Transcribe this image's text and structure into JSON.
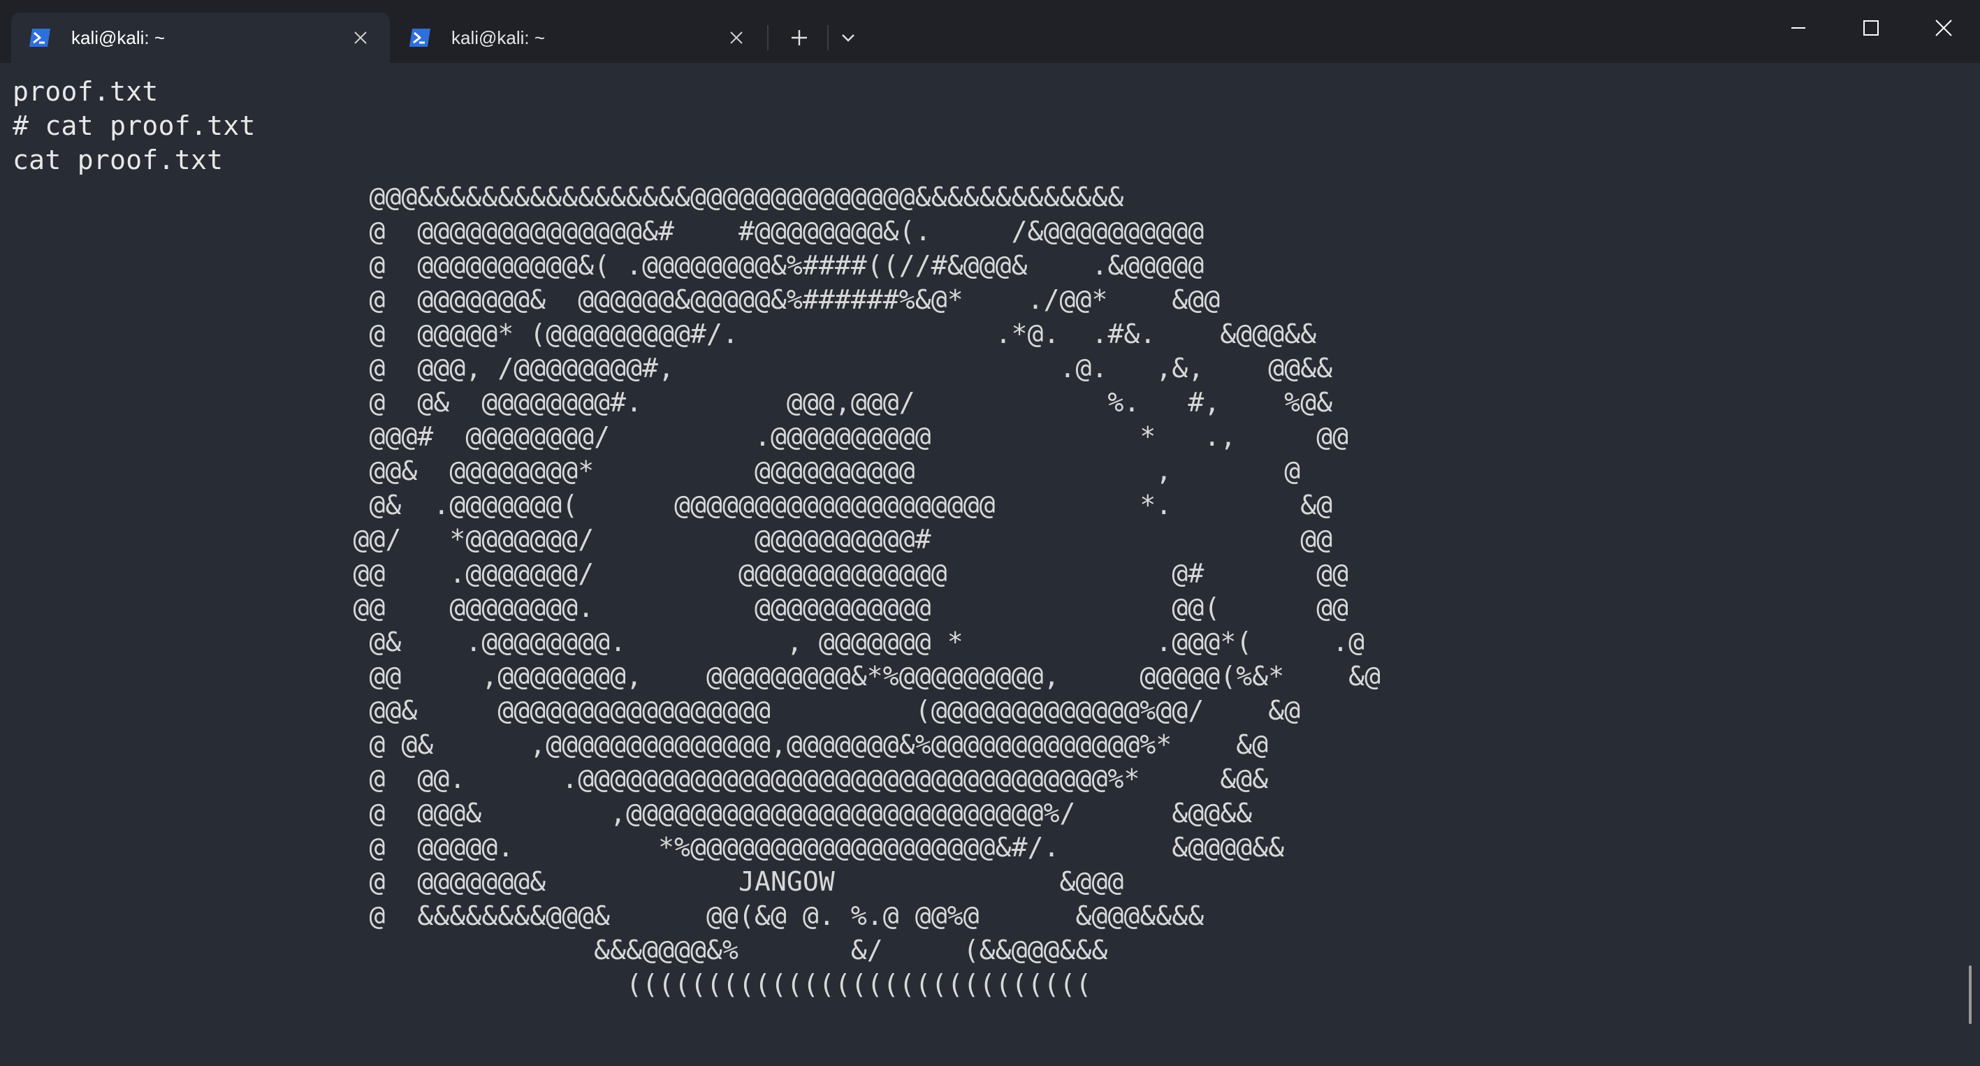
{
  "tabs": [
    {
      "title": "kali@kali: ~",
      "icon": "powershell-icon",
      "active": true
    },
    {
      "title": "kali@kali: ~",
      "icon": "powershell-icon",
      "active": false
    }
  ],
  "colors": {
    "titlebar": "#1f2126",
    "terminal_bg": "#282c34",
    "text": "#e8e8e8",
    "tab_icon": "#2f6fdb"
  },
  "terminal": {
    "prompt_lines": "proof.txt\n# cat proof.txt\ncat proof.txt",
    "ascii_art": "                       @@@&&&&&&&&&&&&&&&&&@@@@@@@@@@@@@@&&&&&&&&&&&&&\n                       @  @@@@@@@@@@@@@@&#    #@@@@@@@@&(.     /&@@@@@@@@@@\n                       @  @@@@@@@@@@&( .@@@@@@@@&%####((//#&@@@&    .&@@@@@\n                       @  @@@@@@@&  @@@@@@&@@@@@&%######%&@*    ./@@*    &@@\n                       @  @@@@@* (@@@@@@@@@#/.                .*@.  .#&.    &@@@&&\n                       @  @@@, /@@@@@@@@#,                        .@.   ,&,    @@&&\n                       @  @&  @@@@@@@@#.         @@@,@@@/            %.   #,    %@&\n                       @@@#  @@@@@@@@/         .@@@@@@@@@@             *   .,     @@\n                       @@&  @@@@@@@@*          @@@@@@@@@@               ,       @\n                       @&  .@@@@@@@(      @@@@@@@@@@@@@@@@@@@@         *.        &@\n                      @@/   *@@@@@@@/          @@@@@@@@@@#                       @@\n                      @@    .@@@@@@@/         @@@@@@@@@@@@@              @#       @@\n                      @@    @@@@@@@@.          @@@@@@@@@@@               @@(      @@\n                       @&    .@@@@@@@@.          , @@@@@@@ *            .@@@*(     .@\n                       @@     ,@@@@@@@@,    @@@@@@@@@&*%@@@@@@@@@,     @@@@@(%&*    &@\n                       @@&     @@@@@@@@@@@@@@@@@         (@@@@@@@@@@@@@%@@/    &@\n                       @ @&      ,@@@@@@@@@@@@@@,@@@@@@@&%@@@@@@@@@@@@@%*    &@\n                       @  @@.      .@@@@@@@@@@@@@@@@@@@@@@@@@@@@@@@@@%*     &@&\n                       @  @@@&        ,@@@@@@@@@@@@@@@@@@@@@@@@@@%/      &@@&&\n                       @  @@@@@.         *%@@@@@@@@@@@@@@@@@@@&#/.       &@@@@&&\n                       @  @@@@@@@&            JANGOW              &@@@\n                       @  &&&&&&&&@@@&      @@(&@ @. %.@ @@%@      &@@@&&&&\n                                     &&&@@@@&%       &/     (&&@@@&&&\n                                       ((((((((((((((((((((((((((((("
  }
}
